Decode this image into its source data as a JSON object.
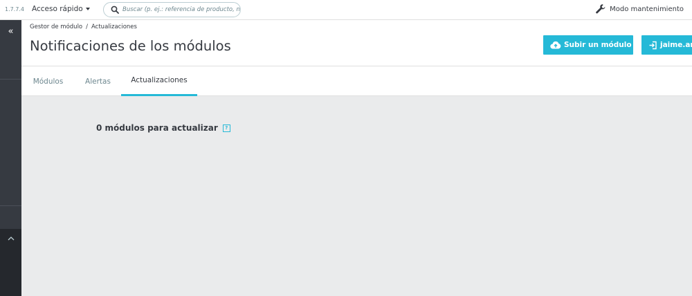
{
  "topbar": {
    "version": "1.7.7.4",
    "quick_access_label": "Acceso rápido",
    "search_placeholder": "Buscar (p. ej.: referencia de producto, n",
    "maintenance_label": "Modo mantenimiento"
  },
  "sidebar": {
    "collapse_glyph": "«"
  },
  "header": {
    "breadcrumb": [
      "Gestor de módulo",
      "Actualizaciones"
    ],
    "breadcrumb_separator": "/",
    "title": "Notificaciones de los módulos",
    "upload_button": "Subir un módulo",
    "user_button": "jaime.ar",
    "accent_color": "#25b9d7"
  },
  "tabs": [
    {
      "label": "Módulos",
      "active": false
    },
    {
      "label": "Alertas",
      "active": false
    },
    {
      "label": "Actualizaciones",
      "active": true
    }
  ],
  "main": {
    "count_text": "0 módulos para actualizar",
    "help_glyph": "?"
  },
  "icons": {
    "search": "search-icon",
    "wrench": "wrench-icon",
    "upload": "cloud-upload-icon",
    "user": "sign-in-icon",
    "collapse": "double-chevron-left-icon",
    "up": "chevron-up-icon"
  }
}
